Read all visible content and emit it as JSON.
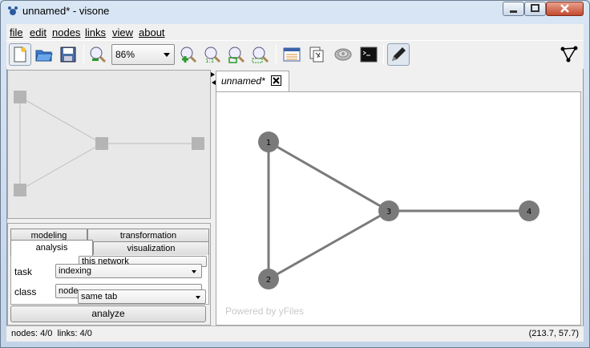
{
  "window": {
    "title": "unnamed* - visone"
  },
  "menu": [
    "file",
    "edit",
    "nodes",
    "links",
    "view",
    "about"
  ],
  "toolbar": {
    "zoom_value": "86%",
    "icons": [
      "new-document-icon",
      "open-folder-icon",
      "save-icon",
      "zoom-out-icon",
      "zoom-in-icon",
      "zoom-actual-size-icon",
      "zoom-fit-icon",
      "zoom-selection-icon",
      "attribute-manager-icon",
      "layout-icon",
      "database-icon",
      "console-icon",
      "pen-icon",
      "network-icon"
    ]
  },
  "panel": {
    "tabs": {
      "modeling": "modeling",
      "transformation": "transformation",
      "analysis": "analysis",
      "visualization": "visualization"
    },
    "network_scope": "this network",
    "task_label": "task",
    "task_value": "indexing",
    "class_label": "class",
    "class_value": "node",
    "target_value": "same tab",
    "analyze_label": "analyze"
  },
  "document": {
    "tab_label": "unnamed*",
    "watermark": "Powered by yFiles"
  },
  "graph": {
    "nodes": [
      {
        "id": "1",
        "label": "1"
      },
      {
        "id": "2",
        "label": "2"
      },
      {
        "id": "3",
        "label": "3"
      },
      {
        "id": "4",
        "label": "4"
      }
    ],
    "edges": [
      [
        "1",
        "2"
      ],
      [
        "1",
        "3"
      ],
      [
        "2",
        "3"
      ],
      [
        "3",
        "4"
      ]
    ],
    "node_color": "#7a7a7a",
    "edge_color": "#7a7a7a"
  },
  "status": {
    "left": "nodes: 4/0  links: 4/0",
    "right": "(213.7, 57.7)"
  }
}
